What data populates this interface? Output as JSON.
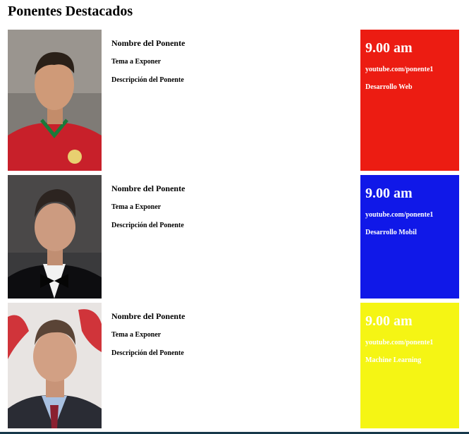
{
  "page": {
    "title": "Ponentes Destacados"
  },
  "speakers": [
    {
      "photo_icon": "speaker-photo-1",
      "name": "Nombre del Ponente",
      "topic": "Tema a Exponer",
      "description": "Descripción del Ponente",
      "time": "9.00 am",
      "link": "youtube.com/ponente1",
      "track": "Desarrollo Web",
      "card_color": "#ec1c12"
    },
    {
      "photo_icon": "speaker-photo-2",
      "name": "Nombre del Ponente",
      "topic": "Tema a Exponer",
      "description": "Descripción del Ponente",
      "time": "9.00 am",
      "link": "youtube.com/ponente1",
      "track": "Desarrollo Mobil",
      "card_color": "#1018e8"
    },
    {
      "photo_icon": "speaker-photo-3",
      "name": "Nombre del Ponente",
      "topic": "Tema a Exponer",
      "description": "Descripción del Ponente",
      "time": "9.00 am",
      "link": "youtube.com/ponente1",
      "track": "Machine Learning",
      "card_color": "#f5f514"
    }
  ]
}
